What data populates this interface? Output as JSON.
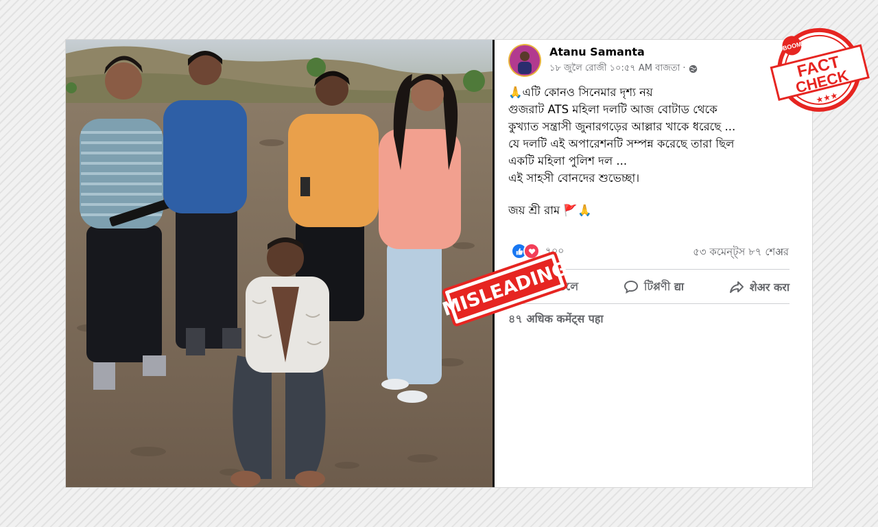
{
  "post": {
    "author": "Atanu Samanta",
    "timestamp": "১৮ জুলৈ রোজী ১০:৫৭ AM বাজতা ·",
    "privacy_icon": "globe-icon",
    "more_icon": "···",
    "text_lines": [
      "🙏এটি কোনও সিনেমার দৃশ্য নয়",
      "গুজরাট ATS মহিলা দলটি আজ বোটাড থেকে",
      "কুখ্যাত সন্ত্রাসী জুনারগড়ের আল্লার খাকে ধরেছে ...",
      "যে দলটি এই অপারেশনটি সম্পন্ন করেছে তারা ছিল",
      "একটি মহিলা পুলিশ দল ...",
      "এই সাহসী বোনদের শুভেচ্ছা।"
    ],
    "closing_line": "জয় শ্রী রাম 🚩🙏",
    "reaction_count": "৭০০",
    "stats": "৫৩ কমেন্ট্স ৮৭ শেअর",
    "actions": {
      "like": "ডলে",
      "comment": "টিপ্পণী द्या",
      "share": "शेअर करा"
    },
    "more_comments": "৪৭ अधिक कमेंट्स पहा"
  },
  "overlay": {
    "misleading_label": "MISLEADING",
    "misleading_color": "#e62521",
    "stamp_top": "BOOM",
    "stamp_line1": "FACT",
    "stamp_line2": "CHECK",
    "stamp_color": "#e62521"
  },
  "colors": {
    "facebook_blue": "#1877f2",
    "love_red": "#f33e58",
    "text_grey": "#65676b"
  }
}
